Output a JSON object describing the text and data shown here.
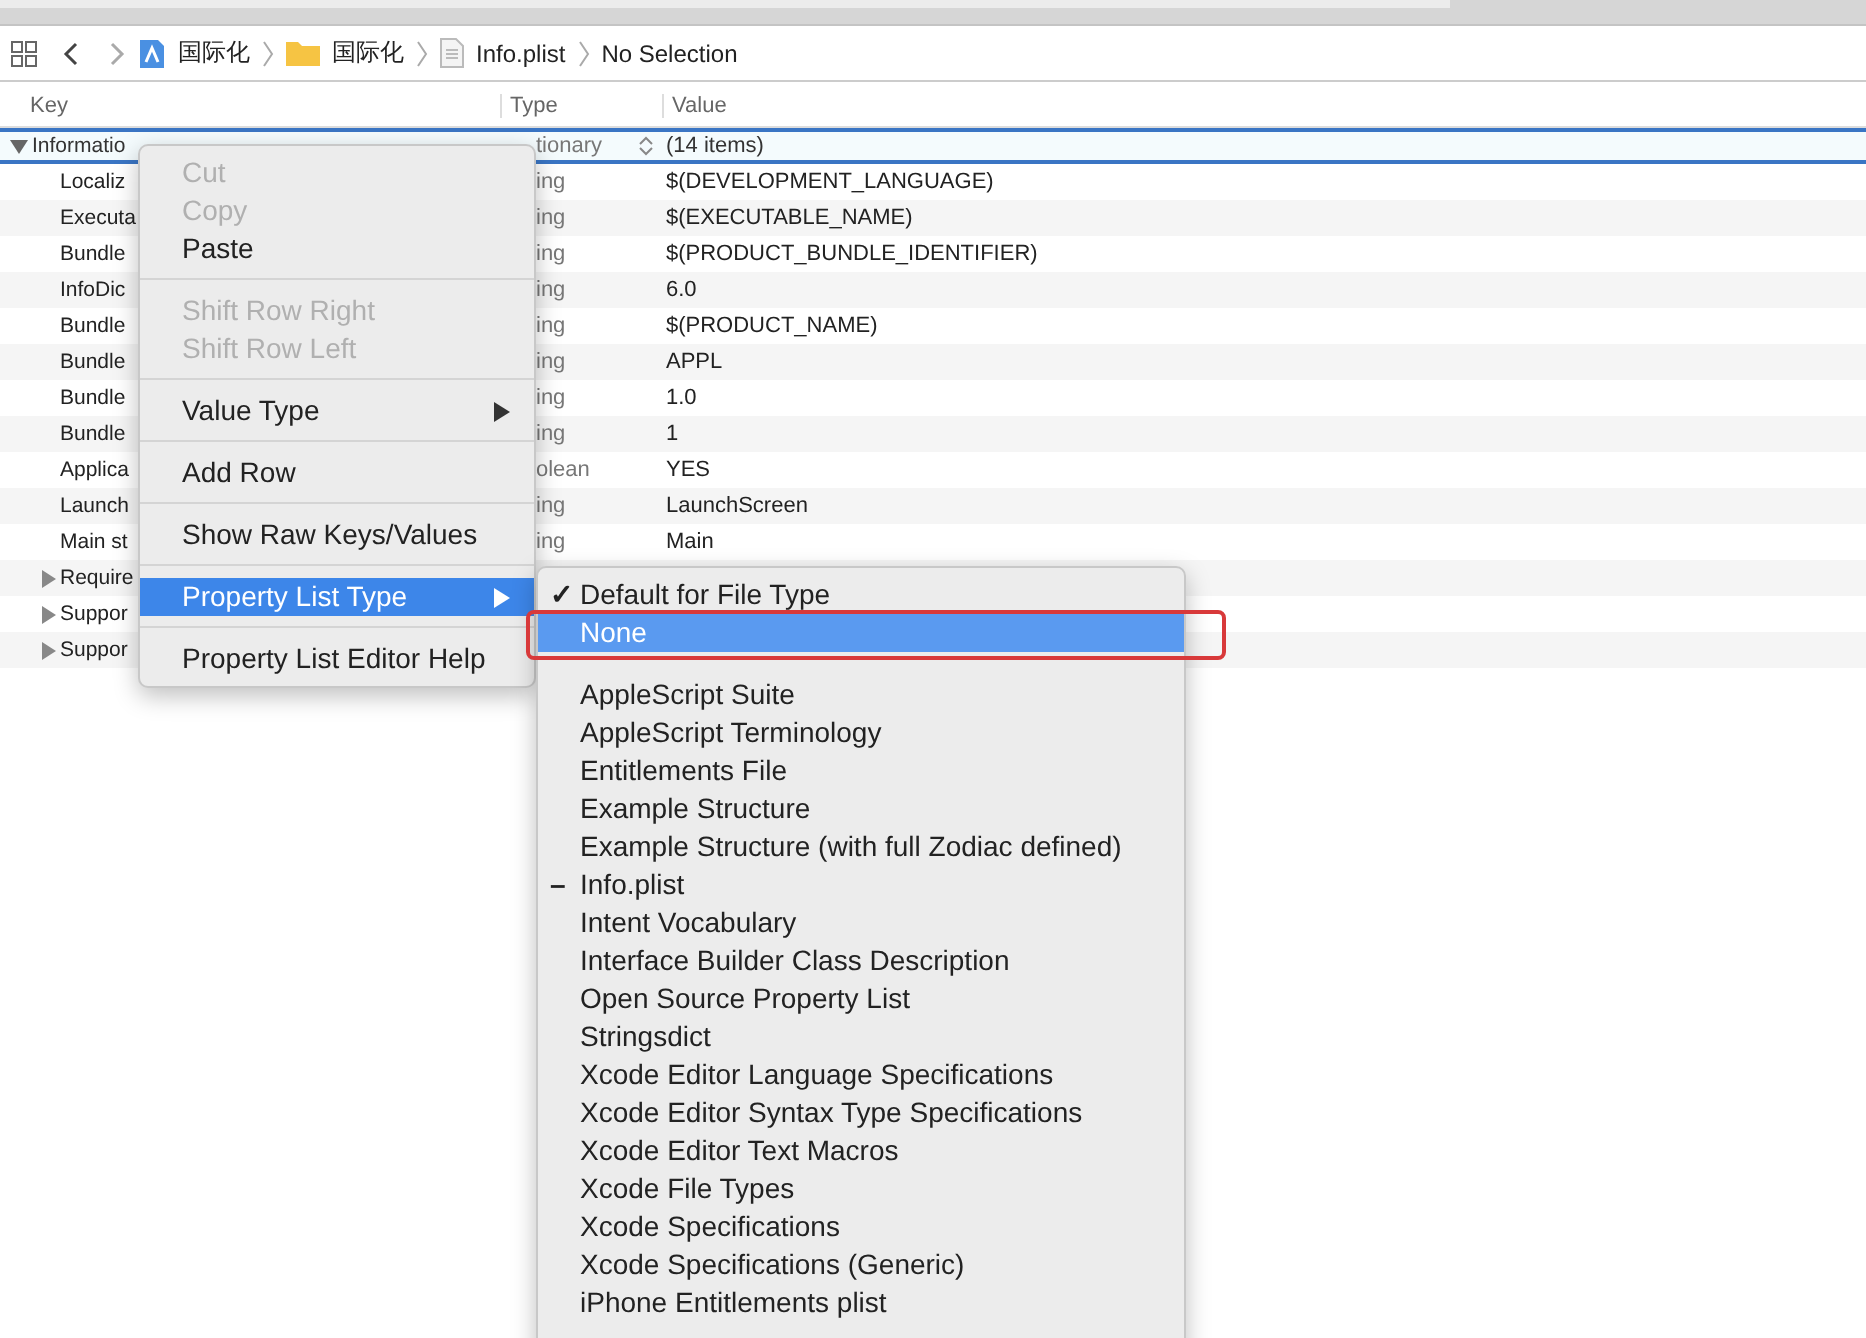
{
  "path_bar": {
    "crumbs": [
      {
        "kind": "project",
        "label": "国际化"
      },
      {
        "kind": "folder",
        "label": "国际化"
      },
      {
        "kind": "file",
        "label": "Info.plist"
      },
      {
        "kind": "text",
        "label": "No Selection"
      }
    ]
  },
  "table": {
    "columns": [
      "Key",
      "Type",
      "Value"
    ],
    "root": {
      "key": "Informatio",
      "type": "tionary",
      "value": "(14 items)",
      "expanded": true
    },
    "rows": [
      {
        "key": "Localiz",
        "type": "ing",
        "value": "$(DEVELOPMENT_LANGUAGE)"
      },
      {
        "key": "Executa",
        "type": "ing",
        "value": "$(EXECUTABLE_NAME)"
      },
      {
        "key": "Bundle",
        "type": "ing",
        "value": "$(PRODUCT_BUNDLE_IDENTIFIER)"
      },
      {
        "key": "InfoDic",
        "type": "ing",
        "value": "6.0"
      },
      {
        "key": "Bundle",
        "type": "ing",
        "value": "$(PRODUCT_NAME)"
      },
      {
        "key": "Bundle",
        "type": "ing",
        "value": "APPL"
      },
      {
        "key": "Bundle",
        "type": "ing",
        "value": "1.0"
      },
      {
        "key": "Bundle",
        "type": "ing",
        "value": "1"
      },
      {
        "key": "Applica",
        "type": "olean",
        "value": "YES"
      },
      {
        "key": "Launch",
        "type": "ing",
        "value": "LaunchScreen"
      },
      {
        "key": "Main st",
        "type": "ing",
        "value": "Main"
      },
      {
        "key": "Require",
        "expanded": false
      },
      {
        "key": "Suppor",
        "expanded": false
      },
      {
        "key": "Suppor",
        "expanded": false
      }
    ]
  },
  "context_menu": {
    "items": [
      {
        "kind": "item",
        "label": "Cut",
        "disabled": true,
        "submenu": false,
        "selected": false
      },
      {
        "kind": "item",
        "label": "Copy",
        "disabled": true,
        "submenu": false,
        "selected": false
      },
      {
        "kind": "item",
        "label": "Paste",
        "disabled": false,
        "submenu": false,
        "selected": false
      },
      {
        "kind": "separator"
      },
      {
        "kind": "item",
        "label": "Shift Row Right",
        "disabled": true,
        "submenu": false,
        "selected": false
      },
      {
        "kind": "item",
        "label": "Shift Row Left",
        "disabled": true,
        "submenu": false,
        "selected": false
      },
      {
        "kind": "separator"
      },
      {
        "kind": "item",
        "label": "Value Type",
        "disabled": false,
        "submenu": true,
        "selected": false
      },
      {
        "kind": "separator"
      },
      {
        "kind": "item",
        "label": "Add Row",
        "disabled": false,
        "submenu": false,
        "selected": false
      },
      {
        "kind": "separator"
      },
      {
        "kind": "item",
        "label": "Show Raw Keys/Values",
        "disabled": false,
        "submenu": false,
        "selected": false
      },
      {
        "kind": "separator"
      },
      {
        "kind": "item",
        "label": "Property List Type",
        "disabled": false,
        "submenu": true,
        "selected": true
      },
      {
        "kind": "separator"
      },
      {
        "kind": "item",
        "label": "Property List Editor Help",
        "disabled": false,
        "submenu": false,
        "selected": false
      }
    ]
  },
  "submenu": {
    "items": [
      {
        "kind": "item",
        "label": "Default for File Type",
        "mark": "✓",
        "selected": false
      },
      {
        "kind": "item",
        "label": "None",
        "selected": true,
        "annotated": true
      },
      {
        "kind": "separator"
      },
      {
        "kind": "item",
        "label": "AppleScript Suite",
        "selected": false
      },
      {
        "kind": "item",
        "label": "AppleScript Terminology",
        "selected": false
      },
      {
        "kind": "item",
        "label": "Entitlements File",
        "selected": false
      },
      {
        "kind": "item",
        "label": "Example Structure",
        "selected": false
      },
      {
        "kind": "item",
        "label": "Example Structure (with full Zodiac defined)",
        "selected": false
      },
      {
        "kind": "item",
        "label": "Info.plist",
        "mark": "–",
        "selected": false
      },
      {
        "kind": "item",
        "label": "Intent Vocabulary",
        "selected": false
      },
      {
        "kind": "item",
        "label": "Interface Builder Class Description",
        "selected": false
      },
      {
        "kind": "item",
        "label": "Open Source Property List",
        "selected": false
      },
      {
        "kind": "item",
        "label": "Stringsdict",
        "selected": false
      },
      {
        "kind": "item",
        "label": "Xcode Editor Language Specifications",
        "selected": false
      },
      {
        "kind": "item",
        "label": "Xcode Editor Syntax Type Specifications",
        "selected": false
      },
      {
        "kind": "item",
        "label": "Xcode Editor Text Macros",
        "selected": false
      },
      {
        "kind": "item",
        "label": "Xcode File Types",
        "selected": false
      },
      {
        "kind": "item",
        "label": "Xcode Specifications",
        "selected": false
      },
      {
        "kind": "item",
        "label": "Xcode Specifications (Generic)",
        "selected": false
      },
      {
        "kind": "item",
        "label": "iPhone Entitlements plist",
        "selected": false
      }
    ]
  }
}
